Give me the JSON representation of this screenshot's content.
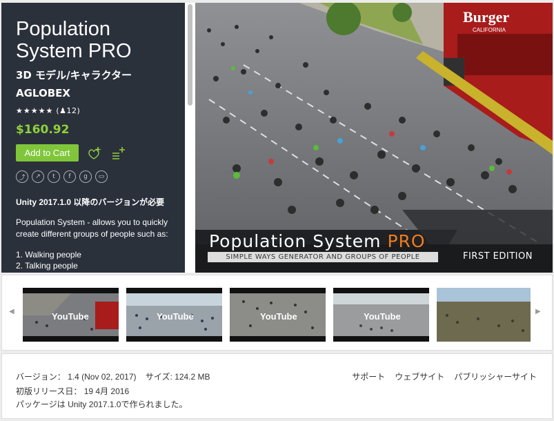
{
  "product": {
    "title": "Population System PRO",
    "category": "3D モデル/キャラクター",
    "publisher": "AGLOBEX",
    "rating_stars": "★★★★★",
    "rating_count": "(♟12)",
    "price": "$160.92",
    "add_to_cart": "Add to Cart",
    "unity_requirement": "Unity 2017.1.0 以降のバージョンが必要",
    "description": "Population System - allows you to quickly create different groups of people such as:",
    "list": [
      "1. Walking people",
      "2. Talking people"
    ]
  },
  "share_icons": [
    "share-icon",
    "reddit-icon",
    "twitter-icon",
    "facebook-icon",
    "google-plus-icon",
    "embed-icon"
  ],
  "hero": {
    "sign_text": "Burger",
    "sign_sub": "CALIFORNIA",
    "title_main": "Population System ",
    "title_accent": "PRO",
    "subtitle": "SIMPLE WAYS GENERATOR AND GROUPS OF PEOPLE",
    "edition": "FIRST EDITION"
  },
  "thumbnails": [
    {
      "label": "YouTube",
      "type": "video"
    },
    {
      "label": "YouTube",
      "type": "video"
    },
    {
      "label": "YouTube",
      "type": "video"
    },
    {
      "label": "YouTube",
      "type": "video"
    },
    {
      "label": "",
      "type": "image"
    }
  ],
  "info": {
    "version": "バージョン： 1.4 (Nov 02, 2017)",
    "size": "サイズ: 124.2 MB",
    "first_release": "初版リリース日： 19 4月 2016",
    "built_with": "パッケージは Unity 2017.1.0で作られました。",
    "links": [
      "サポート",
      "ウェブサイト",
      "パブリッシャーサイト"
    ]
  },
  "colors": {
    "panel_bg": "#2b313b",
    "price_green": "#8fd13a",
    "button_green": "#80c63b",
    "accent_orange": "#f07c1c"
  }
}
